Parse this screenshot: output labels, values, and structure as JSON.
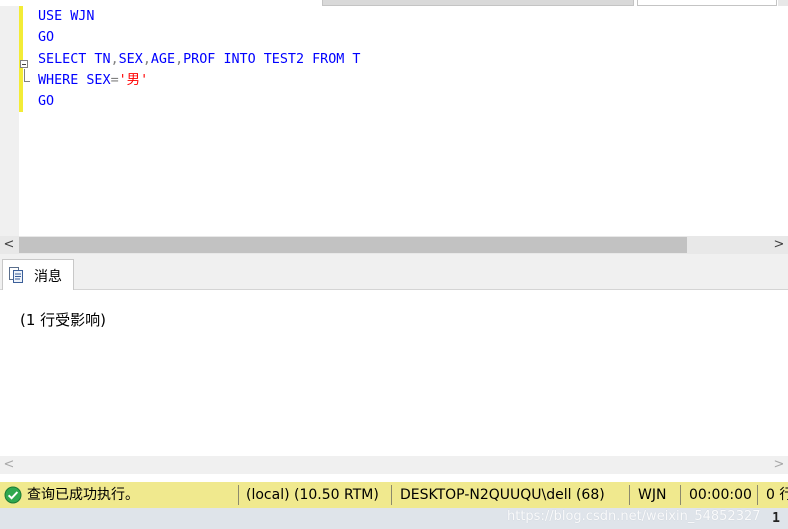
{
  "editor": {
    "lines": [
      [
        {
          "t": "USE",
          "c": "kw"
        },
        {
          "t": " ",
          "c": ""
        },
        {
          "t": "WJN",
          "c": "id"
        }
      ],
      [
        {
          "t": "GO",
          "c": "kw"
        }
      ],
      [
        {
          "t": "SELECT",
          "c": "kw"
        },
        {
          "t": " TN",
          "c": "id"
        },
        {
          "t": ",",
          "c": "op"
        },
        {
          "t": "SEX",
          "c": "id"
        },
        {
          "t": ",",
          "c": "op"
        },
        {
          "t": "AGE",
          "c": "id"
        },
        {
          "t": ",",
          "c": "op"
        },
        {
          "t": "PROF",
          "c": "id"
        },
        {
          "t": " ",
          "c": ""
        },
        {
          "t": "INTO",
          "c": "kw"
        },
        {
          "t": " TEST2 ",
          "c": "id"
        },
        {
          "t": "FROM",
          "c": "kw"
        },
        {
          "t": " T",
          "c": "id"
        }
      ],
      [
        {
          "t": "WHERE",
          "c": "kw"
        },
        {
          "t": " SEX",
          "c": "id"
        },
        {
          "t": "=",
          "c": "op"
        },
        {
          "t": "'男'",
          "c": "str"
        }
      ],
      [
        {
          "t": "GO",
          "c": "kw"
        }
      ]
    ]
  },
  "scrollbars": {
    "left_arrow": "<",
    "right_arrow": ">"
  },
  "results": {
    "tab_label": "消息",
    "message": "(1 行受影响)"
  },
  "status": {
    "ok_text": "查询已成功执行。",
    "server": "(local) (10.50 RTM)",
    "user": "DESKTOP-N2QUUQU\\dell (68)",
    "database": "WJN",
    "elapsed": "00:00:00",
    "rows": "0 行"
  },
  "bottom": {
    "watermark": "https://blog.csdn.net/weixin_54852327",
    "corner": "1"
  },
  "colors": {
    "keyword": "#0000ff",
    "string": "#ff0000",
    "operator": "#808080",
    "change_bar": "#f3ec36",
    "status_bar": "#f0e98e",
    "success": "#2fa84f"
  }
}
